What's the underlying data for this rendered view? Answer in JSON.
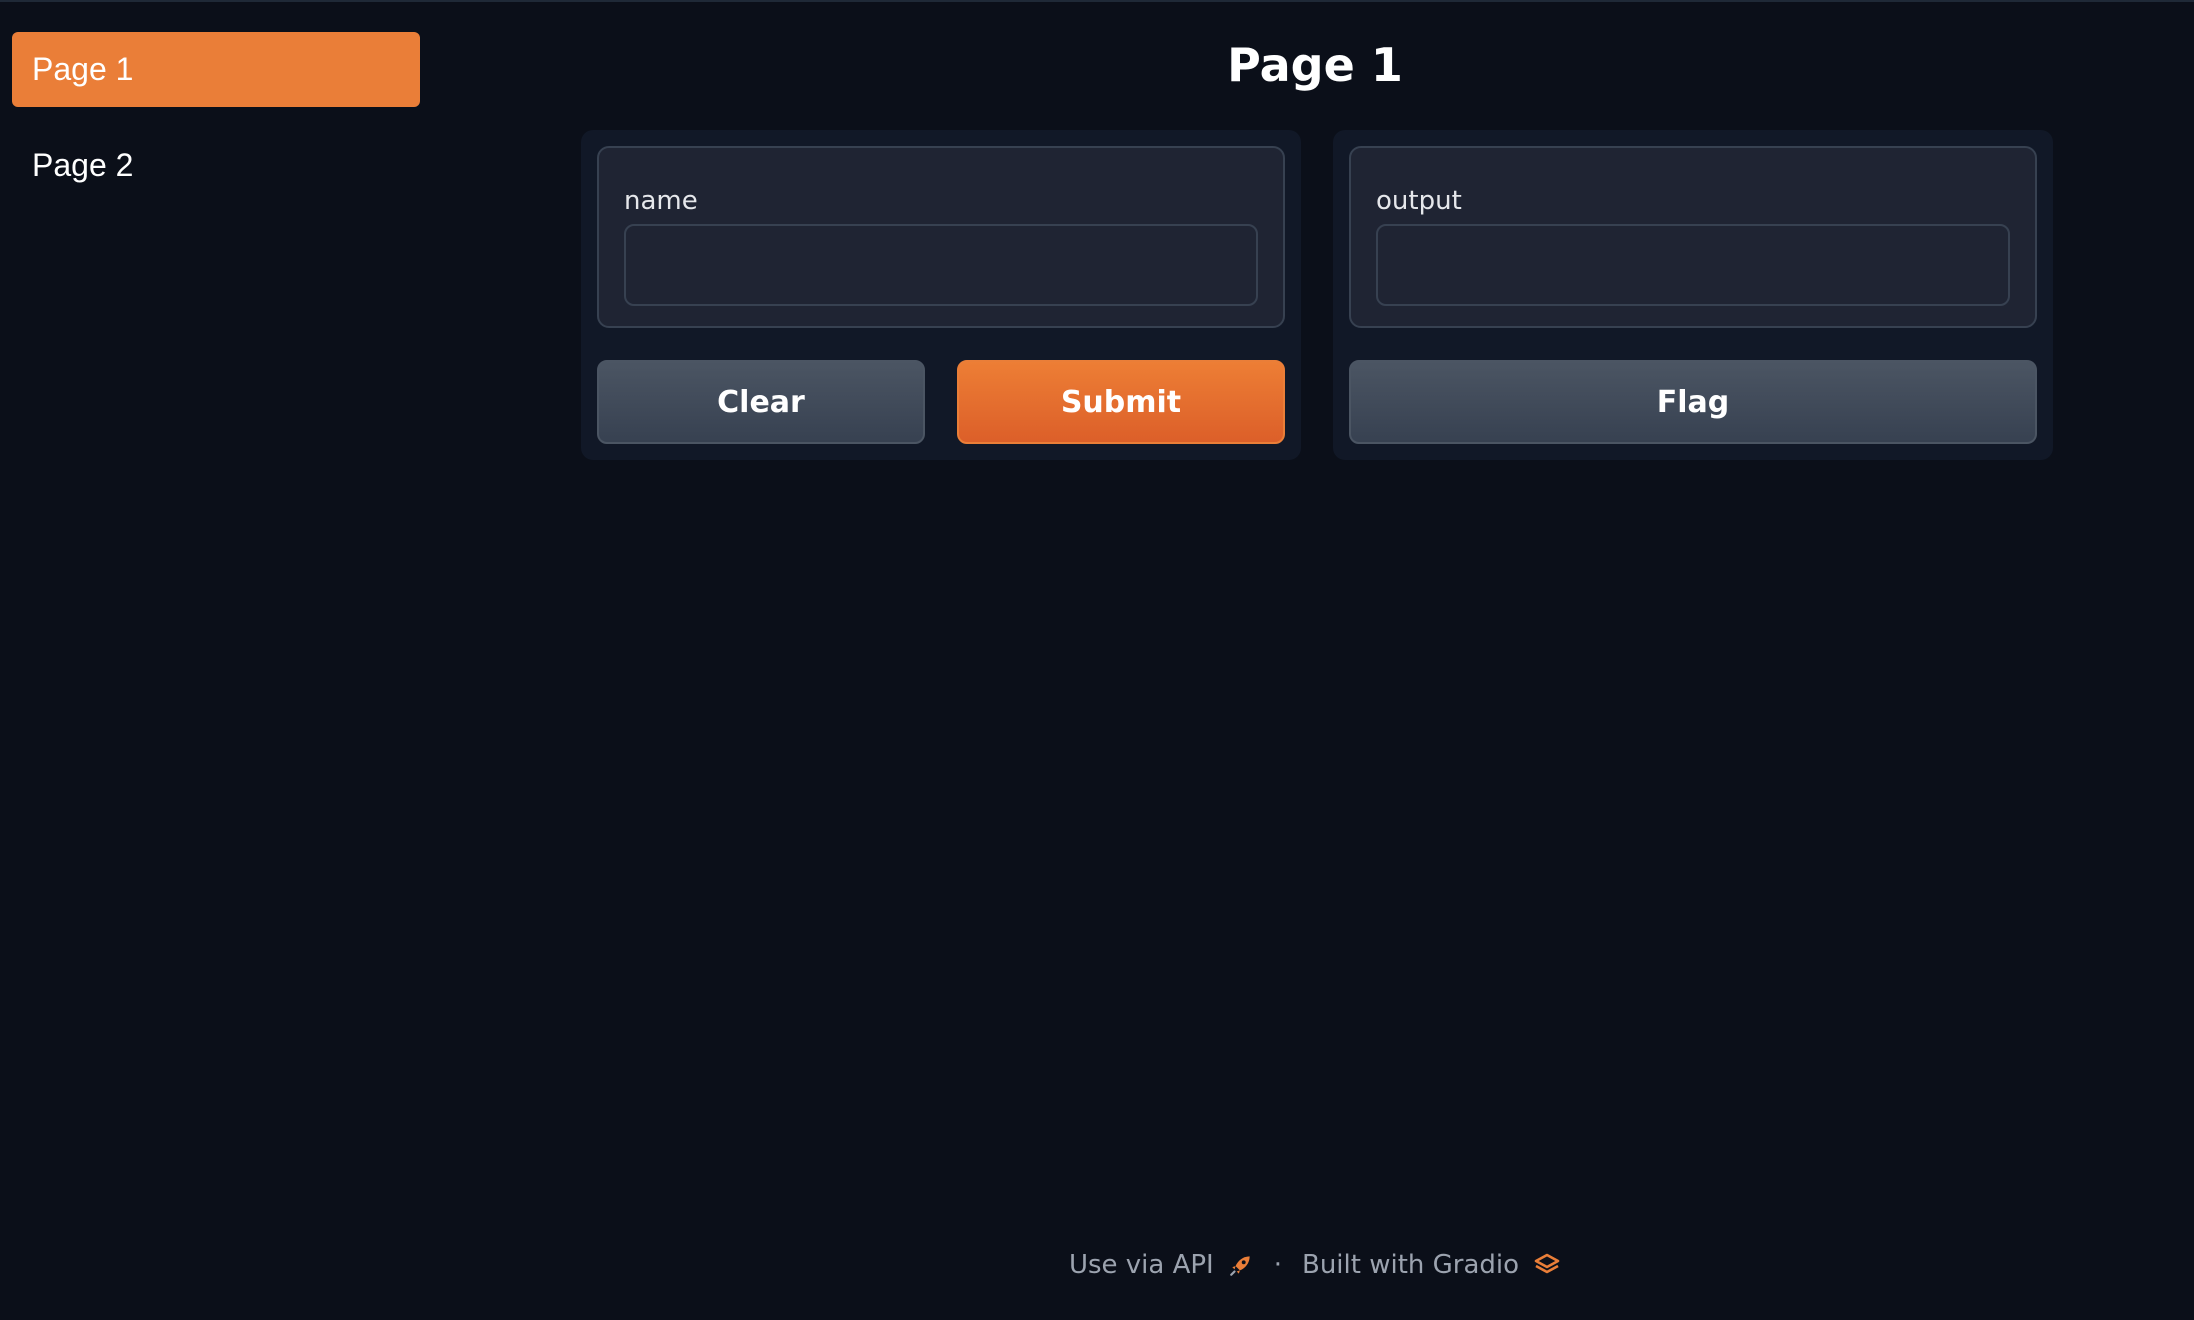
{
  "sidebar": {
    "items": [
      {
        "label": "Page 1",
        "active": true
      },
      {
        "label": "Page 2",
        "active": false
      }
    ]
  },
  "main": {
    "title": "Page 1",
    "input_block": {
      "label": "name",
      "value": ""
    },
    "output_block": {
      "label": "output",
      "value": ""
    },
    "buttons": {
      "clear": "Clear",
      "submit": "Submit",
      "flag": "Flag"
    }
  },
  "footer": {
    "api_link": "Use via API",
    "separator": "·",
    "built_with": "Built with Gradio"
  },
  "colors": {
    "accent": "#ea7e38",
    "background": "#0b0f19",
    "panel": "#111827",
    "secondary_button": "#4b5563"
  },
  "icons": {
    "api": "rocket-icon",
    "gradio": "gradio-logo-icon"
  }
}
